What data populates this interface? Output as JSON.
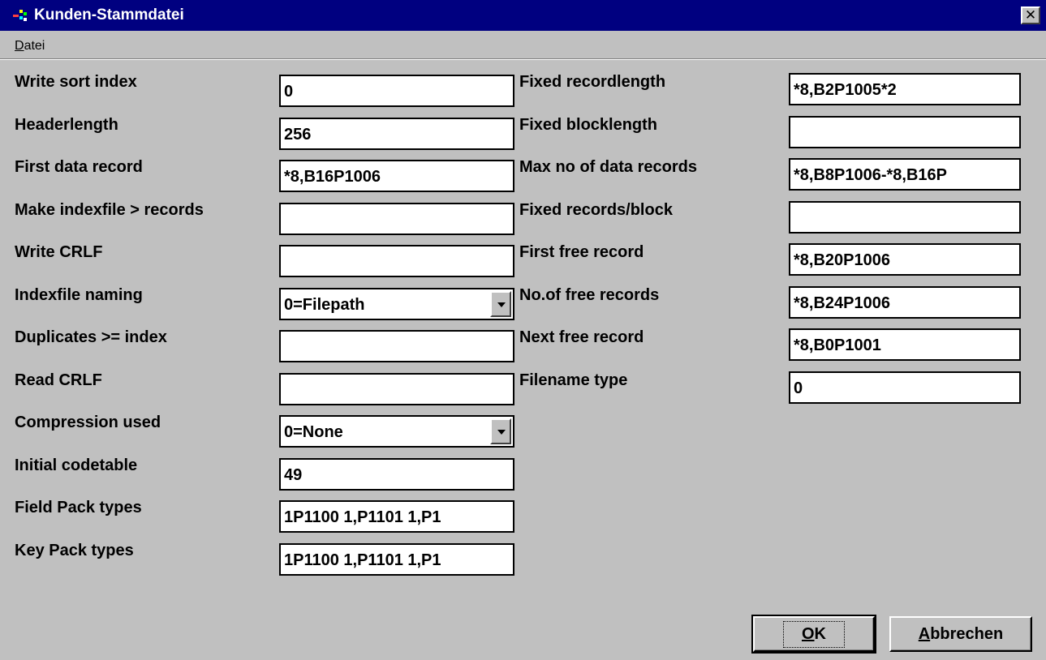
{
  "window": {
    "title": "Kunden-Stammdatei",
    "close_glyph": "✕"
  },
  "menu": {
    "items": [
      {
        "label_first": "D",
        "label_rest": "atei"
      }
    ]
  },
  "left_fields": [
    {
      "label": "Write sort index",
      "value": "0",
      "type": "text"
    },
    {
      "label": "Headerlength",
      "value": "256",
      "type": "text"
    },
    {
      "label": "First data record",
      "value": "*8,B16P1006",
      "type": "text"
    },
    {
      "label": "Make indexfile > records",
      "value": "",
      "type": "text"
    },
    {
      "label": "Write CRLF",
      "value": "",
      "type": "text"
    },
    {
      "label": "Indexfile naming",
      "value": "0=Filepath",
      "type": "combo"
    },
    {
      "label": "Duplicates >= index",
      "value": "",
      "type": "text"
    },
    {
      "label": "Read CRLF",
      "value": "",
      "type": "text"
    },
    {
      "label": "Compression used",
      "value": "0=None",
      "type": "combo"
    },
    {
      "label": "Initial codetable",
      "value": "49",
      "type": "text"
    },
    {
      "label": "Field Pack types",
      "value": "1P1100 1,P1101 1,P1",
      "type": "text"
    },
    {
      "label": "Key Pack types",
      "value": "1P1100 1,P1101 1,P1",
      "type": "text"
    }
  ],
  "right_fields": [
    {
      "label": "Fixed recordlength",
      "value": "*8,B2P1005*2"
    },
    {
      "label": "Fixed blocklength",
      "value": ""
    },
    {
      "label": "Max no of data records",
      "value": "*8,B8P1006-*8,B16P"
    },
    {
      "label": "Fixed records/block",
      "value": ""
    },
    {
      "label": "First free record",
      "value": "*8,B20P1006"
    },
    {
      "label": "No.of free records",
      "value": "*8,B24P1006"
    },
    {
      "label": "Next free record",
      "value": "*8,B0P1001"
    },
    {
      "label": "Filename type",
      "value": "0"
    }
  ],
  "buttons": {
    "ok_first": "O",
    "ok_rest": "K",
    "cancel_first": "A",
    "cancel_rest": "bbrechen"
  },
  "colors": {
    "titlebar": "#000080",
    "face": "#c0c0c0"
  },
  "icons": {
    "app": "app-icon",
    "close": "close-icon",
    "dropdown": "chevron-down-icon"
  }
}
